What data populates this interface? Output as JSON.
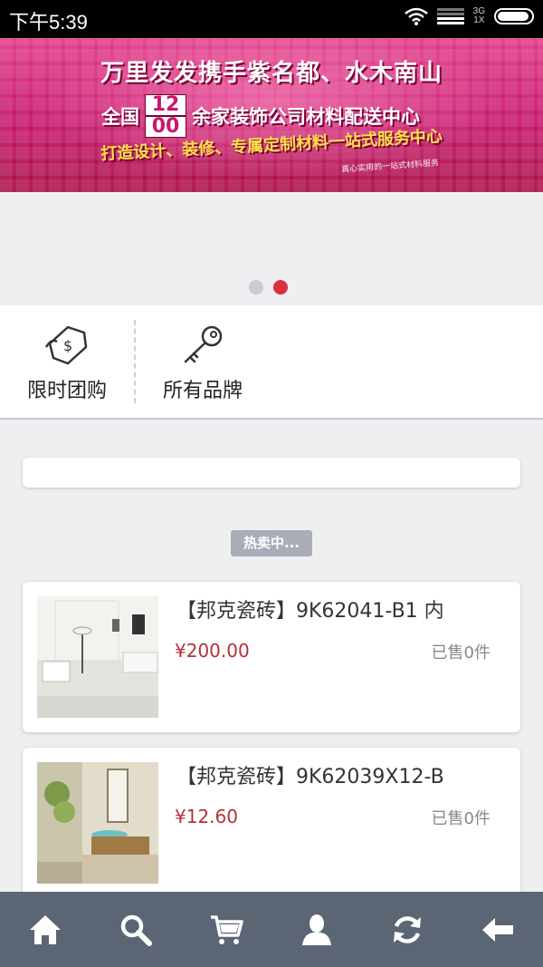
{
  "status_bar": {
    "time": "下午5:39",
    "network_top": "3G",
    "network_bottom": "1X"
  },
  "banner": {
    "line1": "万里发发携手紫名都、水木南山",
    "line2_prefix": "全国",
    "line2_number_top": "12",
    "line2_number_bottom": "00",
    "line2_suffix": "余家装饰公司材料配送中心",
    "line3": "打造设计、装修、专属定制材料一站式服务中心",
    "slogan": "真心实用的一站式材料服务"
  },
  "carousel": {
    "active_index": 2,
    "total": 2
  },
  "quick_nav": [
    {
      "label": "限时团购",
      "icon": "money-tag-icon"
    },
    {
      "label": "所有品牌",
      "icon": "key-icon"
    }
  ],
  "hot_label": "热卖中...",
  "products": [
    {
      "title": "【邦克瓷砖】9K62041-B1 内",
      "price": "¥200.00",
      "sold": "已售0件"
    },
    {
      "title": "【邦克瓷砖】9K62039X12-B",
      "price": "¥12.60",
      "sold": "已售0件"
    }
  ],
  "tab_bar": [
    "home-icon",
    "search-icon",
    "cart-icon",
    "user-icon",
    "refresh-icon",
    "back-arrow-icon"
  ],
  "colors": {
    "accent": "#d9313f",
    "price": "#b3323b",
    "tabbar": "#5c6573",
    "badge": "#a9adb8"
  }
}
